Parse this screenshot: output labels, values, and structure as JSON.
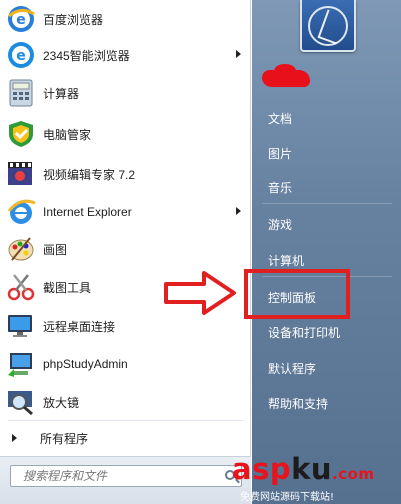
{
  "programs": [
    {
      "label": "百度浏览器",
      "icon": "baidu-browser-icon",
      "has_submenu": false
    },
    {
      "label": "2345智能浏览器",
      "icon": "2345-browser-icon",
      "has_submenu": true
    },
    {
      "label": "计算器",
      "icon": "calculator-icon",
      "has_submenu": false
    },
    {
      "label": "电脑管家",
      "icon": "pc-manager-icon",
      "has_submenu": false
    },
    {
      "label": "视频编辑专家 7.2",
      "icon": "video-editor-icon",
      "has_submenu": false
    },
    {
      "label": "Internet Explorer",
      "icon": "internet-explorer-icon",
      "has_submenu": true
    },
    {
      "label": "画图",
      "icon": "paint-icon",
      "has_submenu": false
    },
    {
      "label": "截图工具",
      "icon": "snipping-tool-icon",
      "has_submenu": false
    },
    {
      "label": "远程桌面连接",
      "icon": "remote-desktop-icon",
      "has_submenu": false
    },
    {
      "label": "phpStudyAdmin",
      "icon": "phpstudy-icon",
      "has_submenu": false
    },
    {
      "label": "放大镜",
      "icon": "magnifier-icon",
      "has_submenu": false
    }
  ],
  "all_programs": "所有程序",
  "search": {
    "placeholder": "搜索程序和文件"
  },
  "right_menu": [
    {
      "label": "文档"
    },
    {
      "label": "图片"
    },
    {
      "label": "音乐"
    },
    {
      "label": "游戏"
    },
    {
      "label": "计算机"
    },
    {
      "label": "控制面板"
    },
    {
      "label": "设备和打印机"
    },
    {
      "label": "默认程序"
    },
    {
      "label": "帮助和支持"
    }
  ],
  "watermark": {
    "brand_a": "asp",
    "brand_b": "ku",
    "brand_c": ".com",
    "slogan": "免费网站源码下载站!"
  },
  "colors": {
    "right_panel": "#6781a1",
    "annotation": "#e02020",
    "brand_red": "#e8131c"
  }
}
